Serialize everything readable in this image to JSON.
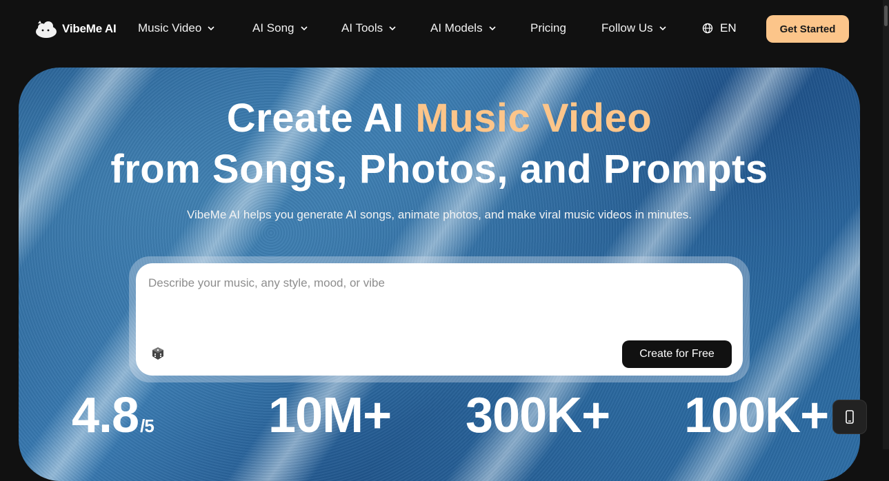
{
  "brand": {
    "name": "VibeMe AI"
  },
  "nav": {
    "items": [
      {
        "label": "Music Video",
        "has_dropdown": true
      },
      {
        "label": "AI Song",
        "has_dropdown": true
      },
      {
        "label": "AI Tools",
        "has_dropdown": true
      },
      {
        "label": "AI Models",
        "has_dropdown": true
      },
      {
        "label": "Pricing",
        "has_dropdown": false
      },
      {
        "label": "Follow Us",
        "has_dropdown": true
      }
    ],
    "language": "EN",
    "cta_label": "Get Started"
  },
  "hero": {
    "title_part1": "Create AI ",
    "title_accent": "Music Video",
    "title_line2": "from Songs, Photos, and Prompts",
    "subtitle": "VibeMe AI helps you generate AI songs, animate photos, and make viral music videos in minutes.",
    "prompt_placeholder": "Describe your music, any style, mood, or vibe",
    "prompt_value": "",
    "create_label": "Create for Free"
  },
  "stats": [
    {
      "value": "4.8",
      "suffix": "/5"
    },
    {
      "value": "10M+",
      "suffix": ""
    },
    {
      "value": "300K+",
      "suffix": ""
    },
    {
      "value": "100K+",
      "suffix": ""
    }
  ],
  "colors": {
    "accent": "#fcc58a",
    "background": "#111111",
    "button_dark": "#111111"
  },
  "icons": [
    "vibeme-logo-icon",
    "chevron-down-icon",
    "globe-icon",
    "dice-icon",
    "phone-icon"
  ]
}
